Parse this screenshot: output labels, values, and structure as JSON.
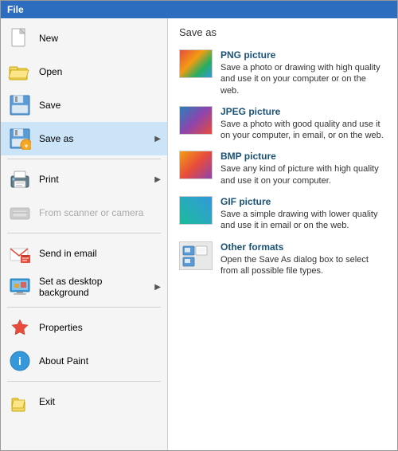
{
  "titleBar": {
    "label": "File"
  },
  "leftPanel": {
    "items": [
      {
        "id": "new",
        "label": "New",
        "icon": "new-icon",
        "hasArrow": false,
        "disabled": false
      },
      {
        "id": "open",
        "label": "Open",
        "icon": "open-icon",
        "hasArrow": false,
        "disabled": false
      },
      {
        "id": "save",
        "label": "Save",
        "icon": "save-icon",
        "hasArrow": false,
        "disabled": false
      },
      {
        "id": "save-as",
        "label": "Save as",
        "icon": "save-as-icon",
        "hasArrow": true,
        "disabled": false,
        "active": true
      },
      {
        "id": "print",
        "label": "Print",
        "icon": "print-icon",
        "hasArrow": true,
        "disabled": false
      },
      {
        "id": "from-scanner",
        "label": "From scanner or camera",
        "icon": "scanner-icon",
        "hasArrow": false,
        "disabled": true
      },
      {
        "id": "send-email",
        "label": "Send in email",
        "icon": "email-icon",
        "hasArrow": false,
        "disabled": false
      },
      {
        "id": "desktop-bg",
        "label": "Set as desktop background",
        "icon": "desktop-icon",
        "hasArrow": true,
        "disabled": false
      },
      {
        "id": "properties",
        "label": "Properties",
        "icon": "properties-icon",
        "hasArrow": false,
        "disabled": false
      },
      {
        "id": "about",
        "label": "About Paint",
        "icon": "about-icon",
        "hasArrow": false,
        "disabled": false
      },
      {
        "id": "exit",
        "label": "Exit",
        "icon": "exit-icon",
        "hasArrow": false,
        "disabled": false
      }
    ]
  },
  "rightPanel": {
    "title": "Save as",
    "formats": [
      {
        "id": "png",
        "title": "PNG picture",
        "desc": "Save a photo or drawing with high quality and use it on your computer or on the web.",
        "thumb": "thumb-png"
      },
      {
        "id": "jpeg",
        "title": "JPEG picture",
        "desc": "Save a photo with good quality and use it on your computer, in email, or on the web.",
        "thumb": "thumb-jpeg"
      },
      {
        "id": "bmp",
        "title": "BMP picture",
        "desc": "Save any kind of picture with high quality and use it on your computer.",
        "thumb": "thumb-bmp"
      },
      {
        "id": "gif",
        "title": "GIF picture",
        "desc": "Save a simple drawing with lower quality and use it in email or on the web.",
        "thumb": "thumb-gif"
      },
      {
        "id": "other",
        "title": "Other formats",
        "desc": "Open the Save As dialog box to select from all possible file types.",
        "thumb": "thumb-other"
      }
    ]
  }
}
